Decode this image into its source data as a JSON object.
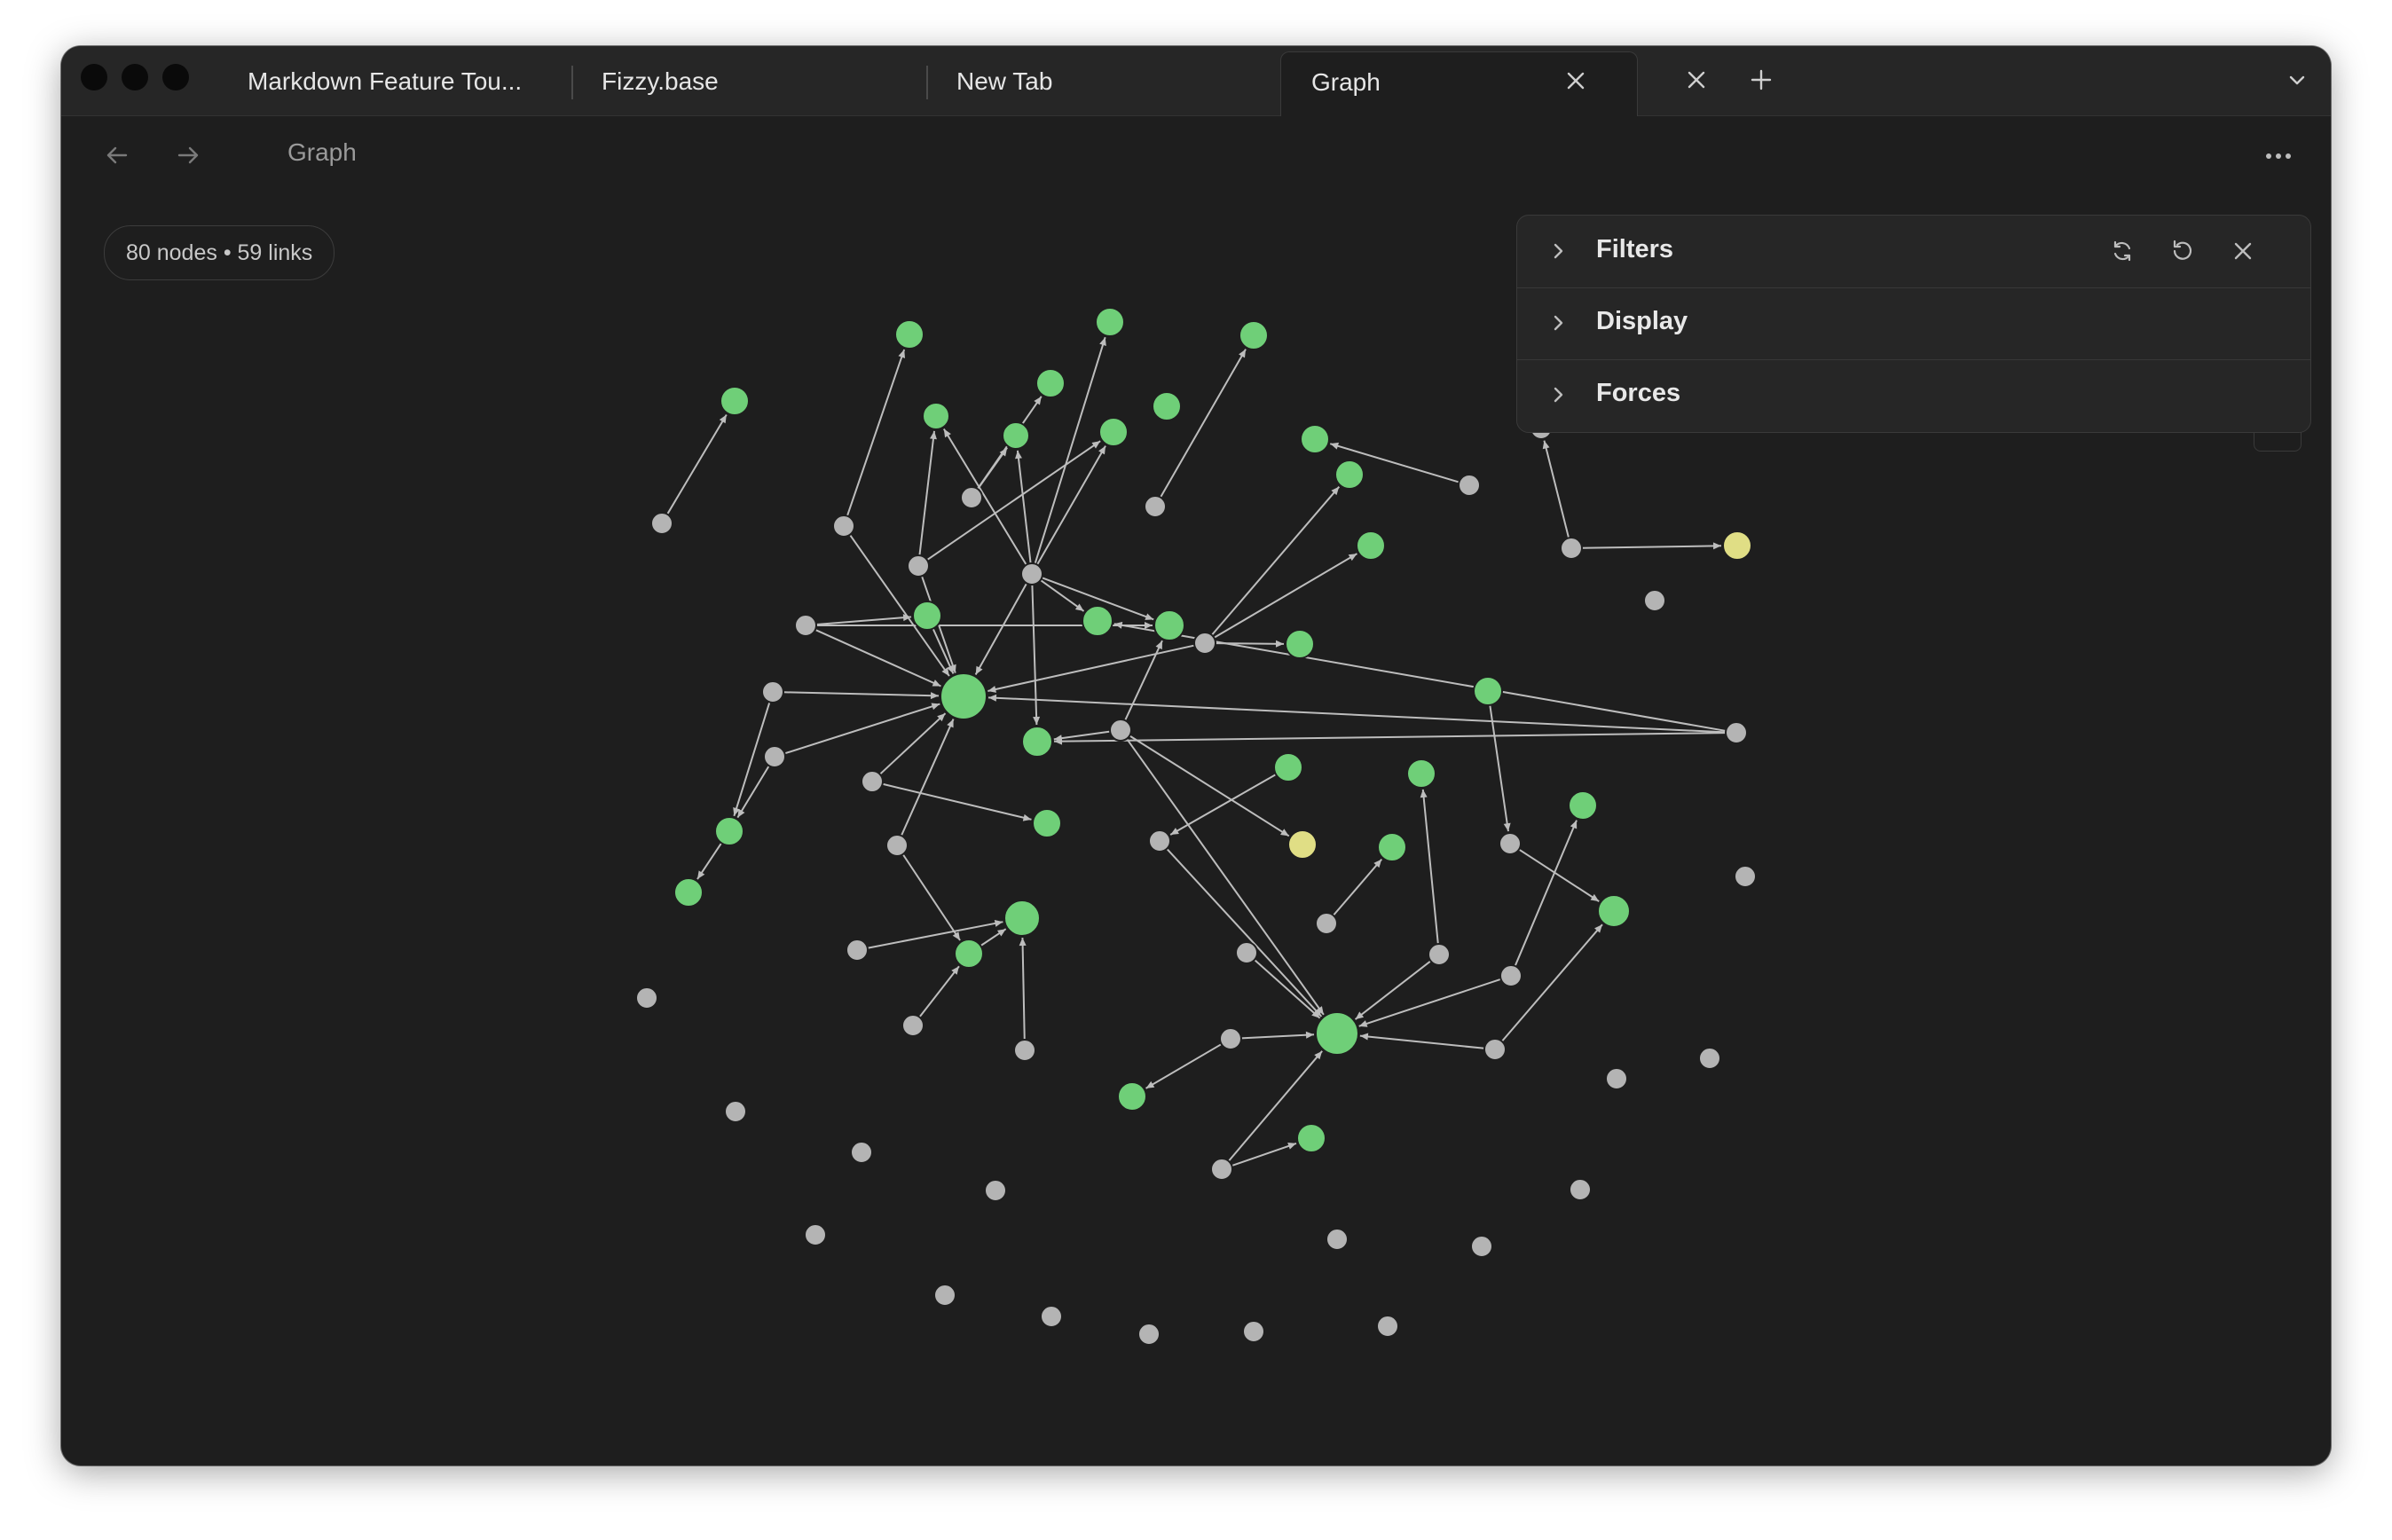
{
  "tabs": [
    {
      "label": "Markdown Feature Tou...",
      "active": false
    },
    {
      "label": "Fizzy.base",
      "active": false
    },
    {
      "label": "New Tab",
      "active": false
    },
    {
      "label": "Graph",
      "active": true
    }
  ],
  "header": {
    "title": "Graph",
    "back_icon": "arrow-left-icon",
    "forward_icon": "arrow-right-icon",
    "more_icon": "more-horizontal-icon"
  },
  "graph": {
    "stats": "80 nodes • 59 links",
    "node_colors": {
      "linked_note": "#6fcf78",
      "orphan": "#b4b4b4",
      "attachment": "#e0de85",
      "edge": "#bdbdbd",
      "background": "#1e1e1e"
    }
  },
  "panel": {
    "sections": [
      {
        "label": "Filters",
        "expanded": false
      },
      {
        "label": "Display",
        "expanded": false
      },
      {
        "label": "Forces",
        "expanded": false
      }
    ],
    "icons": [
      "refresh-icon",
      "reset-icon",
      "close-icon"
    ]
  }
}
